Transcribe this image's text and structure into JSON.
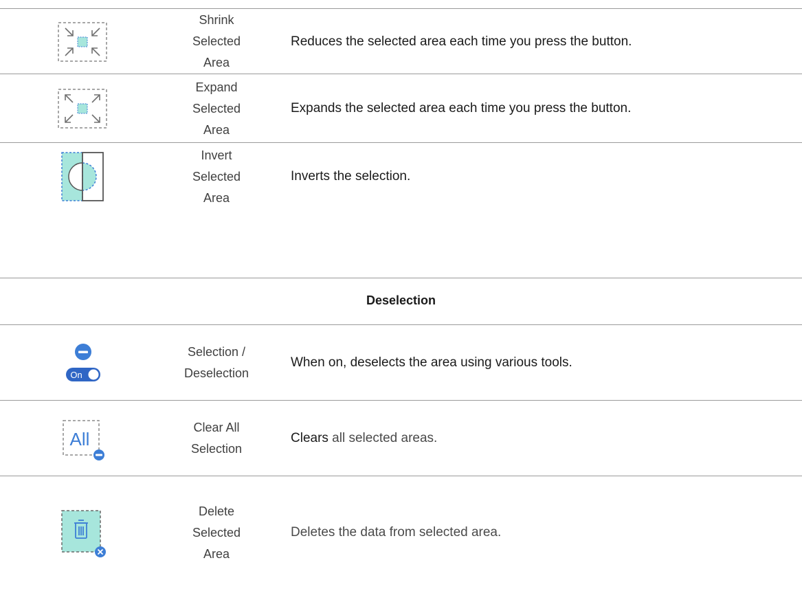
{
  "rows": [
    {
      "icon": "shrink-selected-area-icon",
      "name": "Shrink\nSelected\nArea",
      "description": "Reduces the selected area each time you press the button."
    },
    {
      "icon": "expand-selected-area-icon",
      "name": "Expand\nSelected\nArea",
      "description": "Expands the selected area each time you press the button."
    },
    {
      "icon": "invert-selected-area-icon",
      "name": "Invert\nSelected\nArea",
      "description": "Inverts the selection."
    }
  ],
  "section": {
    "title": "Deselection"
  },
  "deselection_rows": [
    {
      "icon": "deselection-toggle-icon",
      "toggle_label": "On",
      "name": "Selection /\nDeselection",
      "description": "When on, deselects the area using various tools."
    },
    {
      "icon": "clear-all-selection-icon",
      "icon_text": "All",
      "name": "Clear All\nSelection",
      "description_lead": "Clears",
      "description_rest": " all selected areas."
    },
    {
      "icon": "delete-selected-area-icon",
      "name": "Delete\nSelected\nArea",
      "description": "Deletes the data from selected area."
    }
  ],
  "colors": {
    "selection_fill": "#a7e6dc",
    "accent_blue": "#3d7ed6",
    "dashed_gray": "#8a8a8a",
    "rule_gray": "#9a9a9a"
  }
}
